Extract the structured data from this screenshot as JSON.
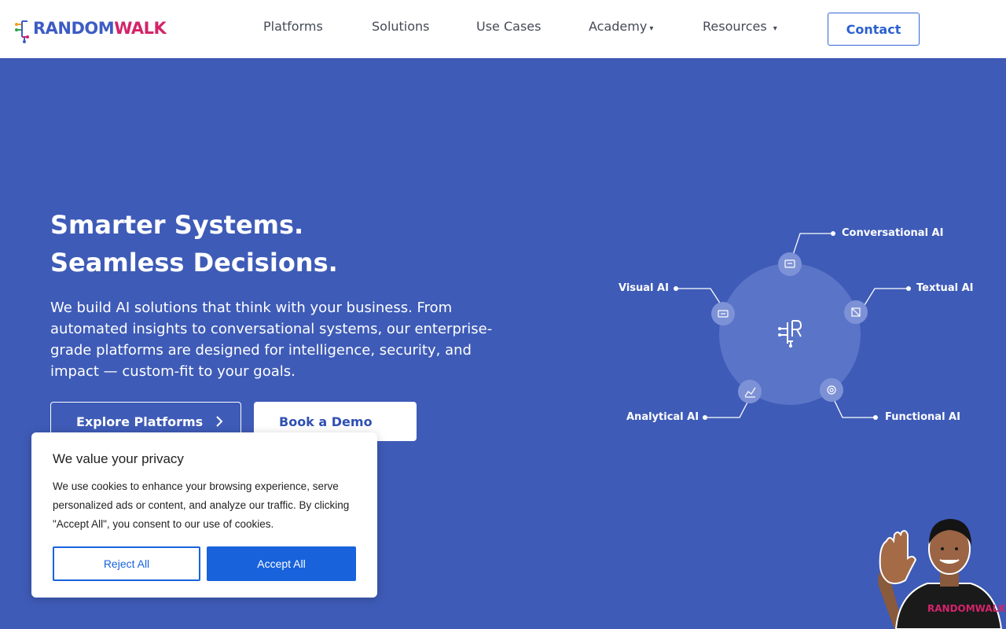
{
  "header": {
    "logo": {
      "text_random": "RANDOM",
      "text_walk": "WALK"
    },
    "nav": [
      {
        "label": "Platforms",
        "has_caret": false
      },
      {
        "label": "Solutions",
        "has_caret": false
      },
      {
        "label": "Use Cases",
        "has_caret": false
      },
      {
        "label": "Academy",
        "has_caret": true
      },
      {
        "label": "Resources",
        "has_caret": true
      }
    ],
    "caret_glyph": "▾",
    "contact_label": "Contact"
  },
  "hero": {
    "title_line1": "Smarter Systems.",
    "title_line2": "Seamless Decisions.",
    "description": "We build AI solutions that think with your business. From automated insights to conversational systems, our enterprise-grade platforms are designed for intelligence, security, and impact — custom-fit to your goals.",
    "explore_label": "Explore Platforms",
    "demo_label": "Book a Demo"
  },
  "diagram": {
    "labels": {
      "conversational": "Conversational AI",
      "textual": "Textual AI",
      "functional": "Functional AI",
      "analytical": "Analytical AI",
      "visual": "Visual AI"
    }
  },
  "cookie": {
    "title": "We value your privacy",
    "text": "We use cookies to enhance your browsing experience, serve personalized ads or content, and analyze our traffic. By clicking \"Accept All\", you consent to our use of cookies.",
    "reject_label": "Reject All",
    "accept_label": "Accept All"
  },
  "colors": {
    "hero_bg": "#3e5bb7",
    "primary_blue": "#1863dc",
    "brand_pink": "#d3246a",
    "brand_blue": "#3d5cc4"
  }
}
